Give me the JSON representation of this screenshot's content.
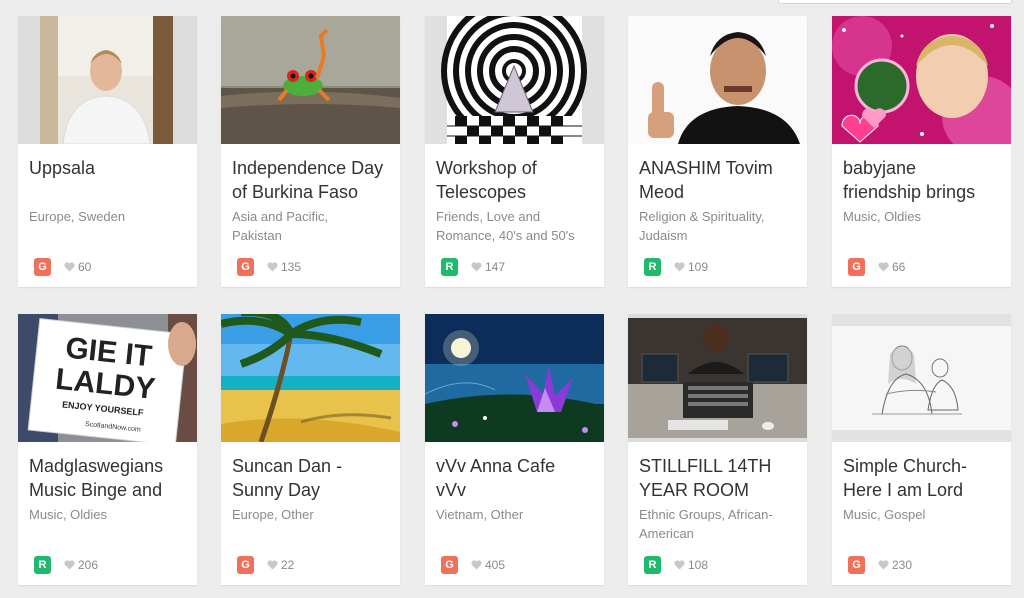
{
  "colors": {
    "background": "#ececec",
    "card": "#ffffff",
    "badge_g": "#f07059",
    "badge_r": "#1fba6c",
    "text": "#333333",
    "muted": "#8a8a8a"
  },
  "cards": [
    {
      "title": "Uppsala",
      "categories": "Europe, Sweden",
      "badge": "G",
      "likes": "60",
      "thumbnail": "man-in-white-shirt-photo"
    },
    {
      "title": "Independence Day\nof Burkina Faso",
      "categories": "Asia and Pacific,\nPakistan",
      "badge": "G",
      "likes": "135",
      "thumbnail": "red-eyed-tree-frog-photo"
    },
    {
      "title": "Workshop of\nTelescopes",
      "categories": "Friends, Love and\nRomance, 40's and 50's",
      "badge": "R",
      "likes": "147",
      "thumbnail": "concentric-circles-album-art"
    },
    {
      "title": "ANASHIM Tovim\nMeod",
      "categories": "Religion & Spirituality,\nJudaism",
      "badge": "R",
      "likes": "109",
      "thumbnail": "man-thumbs-up-photo"
    },
    {
      "title": "babyjane\nfriendship brings",
      "categories": "Music, Oldies",
      "badge": "G",
      "likes": "66",
      "thumbnail": "pink-hearts-collage"
    },
    {
      "title": "Madglaswegians\nMusic Binge and",
      "categories": "Music, Oldies",
      "badge": "R",
      "likes": "206",
      "thumbnail": "gie-it-laldy-sign-photo"
    },
    {
      "title": "Suncan Dan -\nSunny Day",
      "categories": "Europe, Other",
      "badge": "G",
      "likes": "22",
      "thumbnail": "tropical-beach-photo"
    },
    {
      "title": "vVv Anna Cafe\nvVv",
      "categories": "Vietnam, Other",
      "badge": "G",
      "likes": "405",
      "thumbnail": "purple-flower-moonlight-art"
    },
    {
      "title": "STILLFILL 14TH\nYEAR ROOM",
      "categories": "Ethnic Groups, African-\nAmerican",
      "badge": "R",
      "likes": "108",
      "thumbnail": "radio-studio-desk-photo"
    },
    {
      "title": "Simple Church-\nHere I am Lord",
      "categories": "Music, Gospel",
      "badge": "G",
      "likes": "230",
      "thumbnail": "jesus-sketch-drawing"
    }
  ],
  "thumb_text": {
    "sign_line1": "GIE IT",
    "sign_line2": "LALDY",
    "sign_line3": "ENJOY YOURSELF",
    "sign_line4": "ScotlandNow.com"
  }
}
